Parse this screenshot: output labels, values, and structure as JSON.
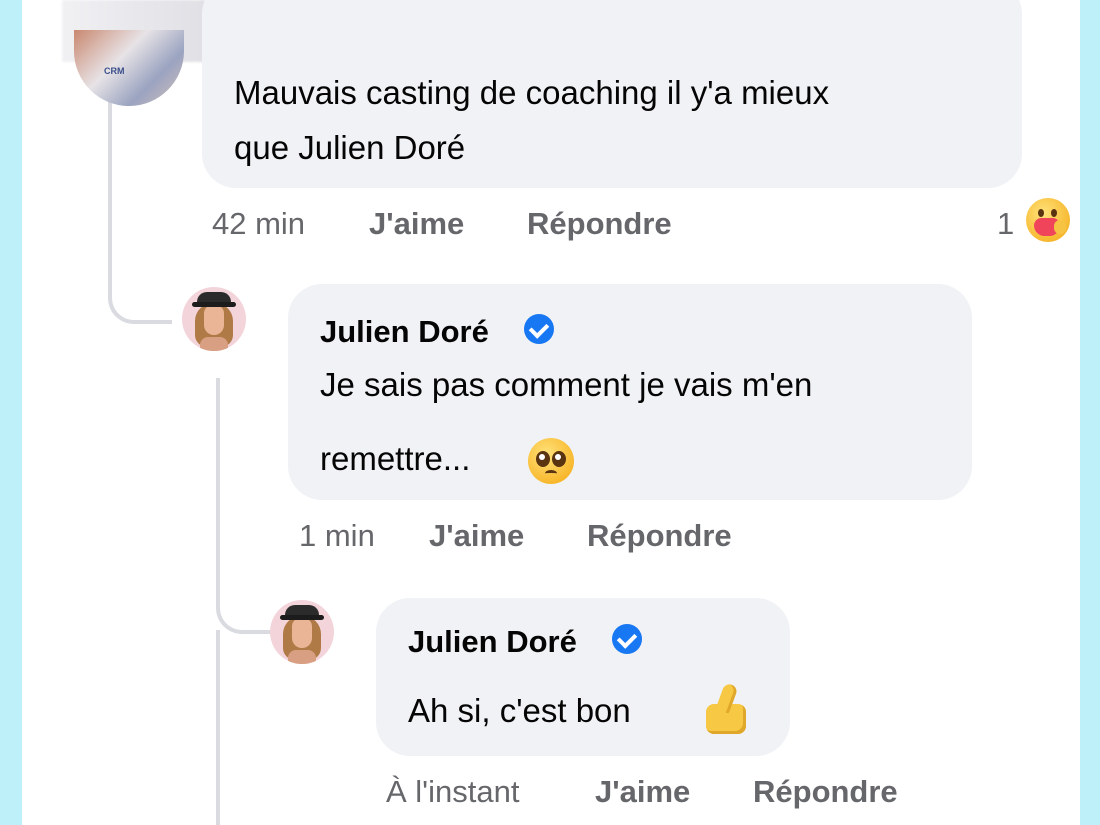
{
  "comment1": {
    "text_line1": "Mauvais casting de coaching il y'a mieux",
    "text_line2": "que Julien Doré",
    "time": "42 min",
    "like_label": "J'aime",
    "reply_label": "Répondre",
    "reaction_count": "1",
    "reaction_icon": "care-emoji-icon",
    "avatar_text": "CRM"
  },
  "reply1": {
    "author": "Julien Doré",
    "verified": true,
    "text_line1": "Je sais pas comment je vais m'en",
    "text_line2": "remettre...",
    "emoji": "pleading-face-emoji",
    "time": "1 min",
    "like_label": "J'aime",
    "reply_label": "Répondre"
  },
  "reply2": {
    "author": "Julien Doré",
    "verified": true,
    "text": "Ah si, c'est bon",
    "emoji": "thumbs-up-emoji",
    "time": "À l'instant",
    "like_label": "J'aime",
    "reply_label": "Répondre"
  },
  "colors": {
    "bubble": "#f0f2f5",
    "meta": "#65676b",
    "verified": "#1877f2",
    "frame": "#bdf0f8"
  }
}
